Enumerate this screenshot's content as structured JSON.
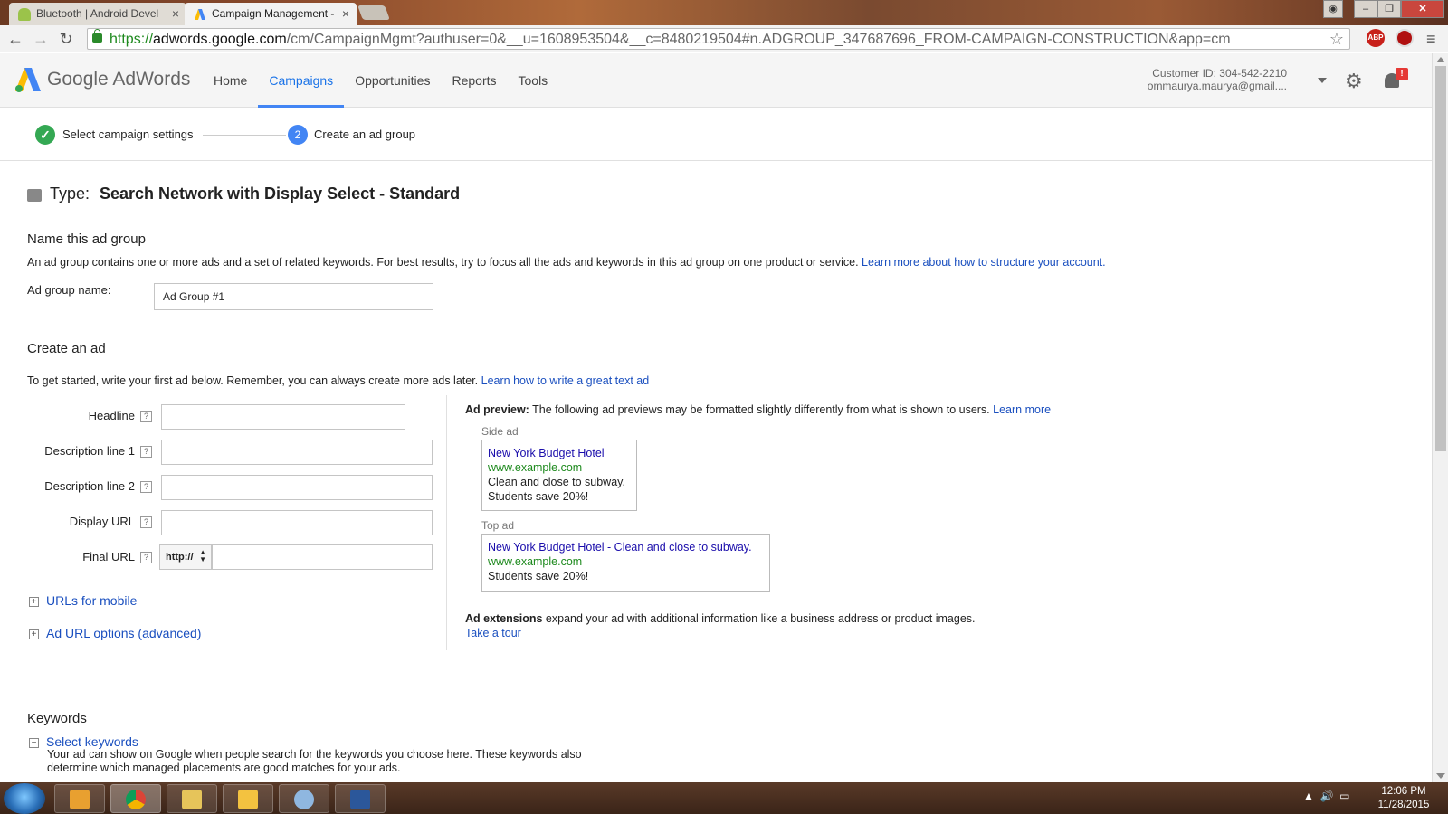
{
  "browser": {
    "tabs": [
      {
        "title": "Bluetooth | Android Devel"
      },
      {
        "title": "Campaign Management -"
      }
    ],
    "url": {
      "scheme": "https://",
      "host": "adwords.google.com",
      "path": "/cm/CampaignMgmt?authuser=0&__u=1608953504&__c=8480219504#n.ADGROUP_347687696_FROM-CAMPAIGN-CONSTRUCTION&app=cm"
    },
    "extension_labels": {
      "abp": "ABP"
    }
  },
  "header": {
    "brand_google": "Google",
    "brand_adwords": "AdWords",
    "nav": [
      "Home",
      "Campaigns",
      "Opportunities",
      "Reports",
      "Tools"
    ],
    "active_nav": "Campaigns",
    "customer_id": "Customer ID: 304-542-2210",
    "account": "ommaurya.maurya@gmail....",
    "notification_badge": "!"
  },
  "stepper": {
    "step1": "Select campaign settings",
    "step2_number": "2",
    "step2": "Create an ad group"
  },
  "type": {
    "label": "Type:",
    "value": "Search Network with Display Select - Standard"
  },
  "ad_group": {
    "heading": "Name this ad group",
    "description": "An ad group contains one or more ads and a set of related keywords. For best results, try to focus all the ads and keywords in this ad group on one product or service.",
    "learn_more": "Learn more about how to structure your account.",
    "name_label": "Ad group name:",
    "name_value": "Ad Group #1"
  },
  "create_ad": {
    "heading": "Create an ad",
    "intro": "To get started, write your first ad below. Remember, you can always create more ads later.",
    "learn_link": "Learn how to write a great text ad",
    "fields": {
      "headline": "Headline",
      "desc1": "Description line 1",
      "desc2": "Description line 2",
      "display_url": "Display URL",
      "final_url": "Final URL"
    },
    "help_glyph": "?",
    "protocol": "http://",
    "urls_mobile": "URLs for mobile",
    "url_options": "Ad URL options (advanced)"
  },
  "preview": {
    "title": "Ad preview:",
    "text": "The following ad previews may be formatted slightly differently from what is shown to users.",
    "learn_more": "Learn more",
    "side_label": "Side ad",
    "side_headline": "New York Budget Hotel",
    "side_url": "www.example.com",
    "side_line1": "Clean and close to subway.",
    "side_line2": "Students save 20%!",
    "top_label": "Top ad",
    "top_headline": "New York Budget Hotel - Clean and close to subway.",
    "top_url": "www.example.com",
    "top_line": "Students save 20%!",
    "ext_title": "Ad extensions",
    "ext_text": "expand your ad with additional information like a business address or product images.",
    "tour": "Take a tour"
  },
  "keywords": {
    "heading": "Keywords",
    "select": "Select keywords",
    "body": "Your ad can show on Google when people search for the keywords you choose here. These keywords also determine which managed placements are good matches for your ads."
  },
  "taskbar": {
    "time": "12:06 PM",
    "date": "11/28/2015"
  }
}
